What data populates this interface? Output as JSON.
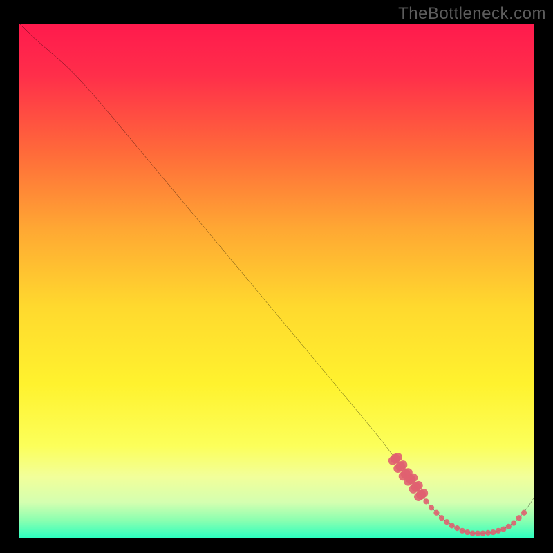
{
  "attribution": "TheBottleneck.com",
  "colors": {
    "bg_black": "#000000",
    "attribution_text": "#5c5c5c",
    "curve_stroke": "#000000",
    "marker_fill": "#e06070",
    "gradient_stops": [
      {
        "offset": 0.0,
        "color": "#ff1a4d"
      },
      {
        "offset": 0.1,
        "color": "#ff2e4a"
      },
      {
        "offset": 0.25,
        "color": "#ff6a3a"
      },
      {
        "offset": 0.4,
        "color": "#ffa833"
      },
      {
        "offset": 0.55,
        "color": "#ffd92e"
      },
      {
        "offset": 0.7,
        "color": "#fff22e"
      },
      {
        "offset": 0.82,
        "color": "#fcff5a"
      },
      {
        "offset": 0.88,
        "color": "#f2ff9a"
      },
      {
        "offset": 0.93,
        "color": "#d4ffb0"
      },
      {
        "offset": 0.965,
        "color": "#8affb0"
      },
      {
        "offset": 1.0,
        "color": "#2affc0"
      }
    ]
  },
  "chart_data": {
    "type": "line",
    "title": "",
    "xlabel": "",
    "ylabel": "",
    "xlim": [
      0,
      100
    ],
    "ylim": [
      0,
      100
    ],
    "grid": false,
    "series": [
      {
        "name": "bottleneck-curve",
        "x": [
          0,
          3,
          6,
          10,
          15,
          20,
          25,
          30,
          35,
          40,
          45,
          50,
          55,
          60,
          65,
          70,
          73,
          76,
          78,
          80,
          82,
          84,
          86,
          88,
          90,
          92,
          94,
          96,
          98,
          100
        ],
        "y": [
          100,
          97,
          94.5,
          91,
          85.5,
          79.5,
          73.5,
          67.5,
          61.5,
          55.5,
          49.5,
          43.5,
          37.5,
          31.5,
          25.5,
          19.5,
          15.5,
          11.5,
          8.5,
          6,
          4,
          2.5,
          1.5,
          1,
          1,
          1.2,
          1.8,
          3,
          5,
          8
        ]
      }
    ],
    "markers": {
      "name": "data-points",
      "x": [
        73,
        74,
        75,
        76,
        77,
        78,
        79,
        80,
        81,
        82,
        83,
        84,
        85,
        86,
        87,
        88,
        89,
        90,
        91,
        92,
        93,
        94,
        95,
        96,
        97,
        98
      ],
      "y": [
        15.5,
        14,
        12.5,
        11.5,
        10,
        8.5,
        7.2,
        6,
        5,
        4,
        3.2,
        2.5,
        2,
        1.5,
        1.2,
        1,
        1,
        1,
        1.1,
        1.2,
        1.5,
        1.8,
        2.3,
        3,
        4,
        5
      ],
      "radius_nominal": 5,
      "emphasized_indices": [
        0,
        1,
        2,
        3,
        4,
        5
      ]
    }
  }
}
